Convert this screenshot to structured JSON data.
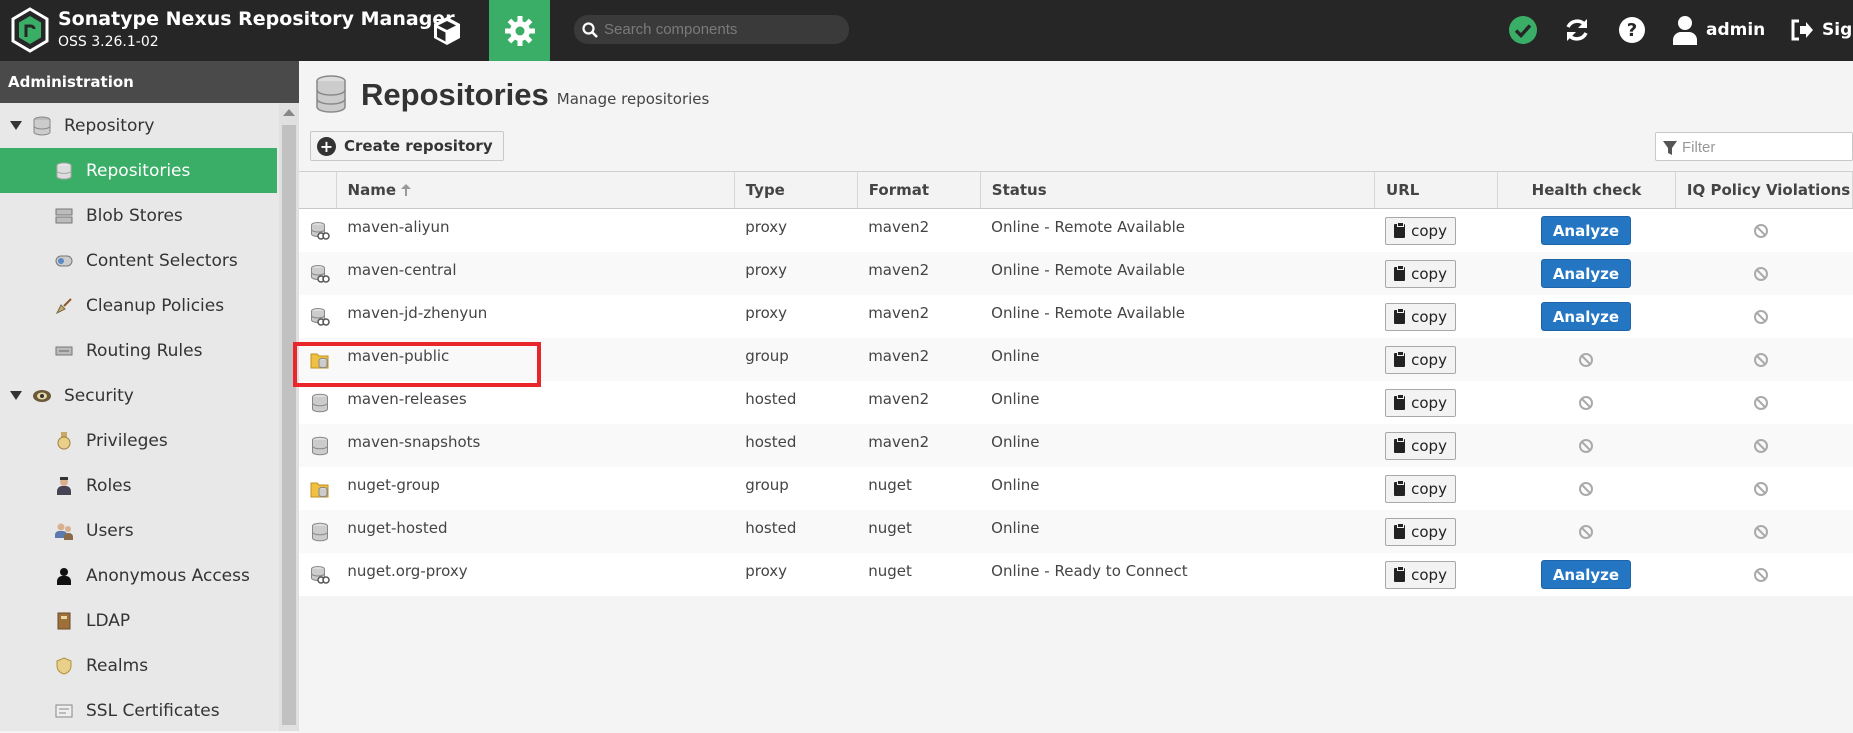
{
  "header": {
    "app_title": "Sonatype Nexus Repository Manager",
    "app_version": "OSS 3.26.1-02",
    "search_placeholder": "Search components",
    "user_label": "admin",
    "signout_label": "Sign out",
    "status_color": "#3aae66",
    "accent_color": "#3aae66"
  },
  "sidebar": {
    "header": "Administration",
    "groups": [
      {
        "label": "Repository",
        "icon": "database-icon",
        "items": [
          {
            "label": "Repositories",
            "icon": "repositories-icon",
            "active": true
          },
          {
            "label": "Blob Stores",
            "icon": "blob-store-icon"
          },
          {
            "label": "Content Selectors",
            "icon": "content-selector-icon"
          },
          {
            "label": "Cleanup Policies",
            "icon": "broom-icon"
          },
          {
            "label": "Routing Rules",
            "icon": "routing-icon"
          }
        ]
      },
      {
        "label": "Security",
        "icon": "security-icon",
        "items": [
          {
            "label": "Privileges",
            "icon": "medal-icon"
          },
          {
            "label": "Roles",
            "icon": "role-icon"
          },
          {
            "label": "Users",
            "icon": "users-icon"
          },
          {
            "label": "Anonymous Access",
            "icon": "anonymous-icon"
          },
          {
            "label": "LDAP",
            "icon": "ldap-book-icon"
          },
          {
            "label": "Realms",
            "icon": "shield-icon"
          },
          {
            "label": "SSL Certificates",
            "icon": "certificate-icon"
          }
        ]
      }
    ]
  },
  "main": {
    "title": "Repositories",
    "subtitle": "Manage repositories",
    "create_button": "Create repository",
    "filter_placeholder": "Filter",
    "columns": [
      "Name",
      "Type",
      "Format",
      "Status",
      "URL",
      "Health check",
      "IQ Policy Violations"
    ],
    "sorted_column": "Name",
    "copy_label": "copy",
    "analyze_label": "Analyze",
    "rows": [
      {
        "icon": "proxy-repo-icon",
        "name": "maven-aliyun",
        "type": "proxy",
        "format": "maven2",
        "status": "Online - Remote Available",
        "health": "analyze"
      },
      {
        "icon": "proxy-repo-icon",
        "name": "maven-central",
        "type": "proxy",
        "format": "maven2",
        "status": "Online - Remote Available",
        "health": "analyze"
      },
      {
        "icon": "proxy-repo-icon",
        "name": "maven-jd-zhenyun",
        "type": "proxy",
        "format": "maven2",
        "status": "Online - Remote Available",
        "health": "analyze"
      },
      {
        "icon": "group-repo-icon",
        "name": "maven-public",
        "type": "group",
        "format": "maven2",
        "status": "Online",
        "health": "none",
        "highlighted": true
      },
      {
        "icon": "hosted-repo-icon",
        "name": "maven-releases",
        "type": "hosted",
        "format": "maven2",
        "status": "Online",
        "health": "none"
      },
      {
        "icon": "hosted-repo-icon",
        "name": "maven-snapshots",
        "type": "hosted",
        "format": "maven2",
        "status": "Online",
        "health": "none"
      },
      {
        "icon": "group-repo-icon",
        "name": "nuget-group",
        "type": "group",
        "format": "nuget",
        "status": "Online",
        "health": "none"
      },
      {
        "icon": "hosted-repo-icon",
        "name": "nuget-hosted",
        "type": "hosted",
        "format": "nuget",
        "status": "Online",
        "health": "none"
      },
      {
        "icon": "proxy-repo-icon",
        "name": "nuget.org-proxy",
        "type": "proxy",
        "format": "nuget",
        "status": "Online - Ready to Connect",
        "health": "analyze"
      }
    ]
  }
}
